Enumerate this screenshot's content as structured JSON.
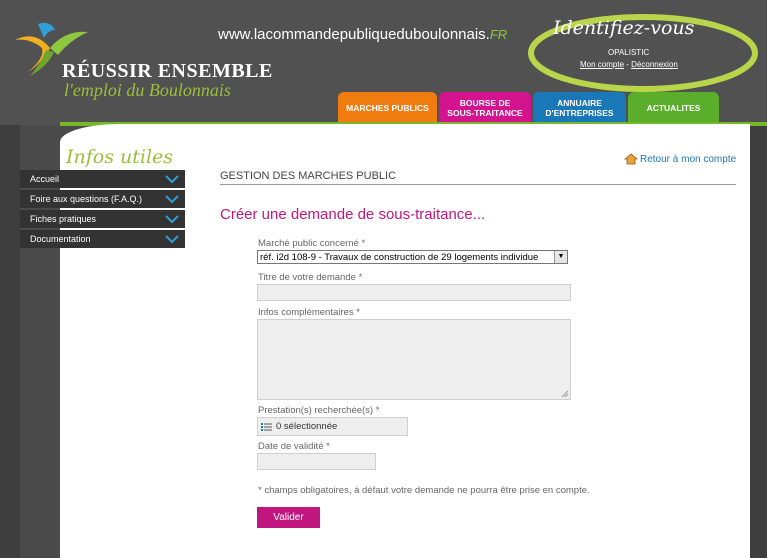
{
  "site": {
    "url": "www.lacommandepubliqueduboulonnais.",
    "url_suffix": "FR"
  },
  "brand": {
    "name": "RÉUSSIR ENSEMBLE",
    "tagline": "l'emploi du Boulonnais"
  },
  "login": {
    "title": "Identifiez-vous",
    "user": "OPALISTIC",
    "account_link": "Mon compte",
    "separator": " - ",
    "logout_link": "Déconnexion"
  },
  "nav": {
    "tabs": [
      {
        "label": "MARCHES PUBLICS",
        "color": "#f07c10"
      },
      {
        "label": "BOURSE DE\nSOUS-TRAITANCE",
        "color": "#d3148e"
      },
      {
        "label": "ANNUAIRE\nD'ENTREPRISES",
        "color": "#1a78b8"
      },
      {
        "label": "ACTUALITES",
        "color": "#5aae2c"
      }
    ]
  },
  "sidebar": {
    "title": "Infos utiles",
    "items": [
      {
        "label": "Accueil"
      },
      {
        "label": "Foire aux questions (F.A.Q.)"
      },
      {
        "label": "Fiches pratiques"
      },
      {
        "label": "Documentation"
      }
    ]
  },
  "main": {
    "retour_label": "Retour à mon compte",
    "section_title": "GESTION DES MARCHES PUBLIC",
    "form_title": "Créer une demande de sous-traitance...",
    "fields": {
      "marche_label": "Marché public concerné *",
      "marche_value": "réf. i2d 108-9 - Travaux de construction de 29 logements individue",
      "titre_label": "Titre de votre demande *",
      "infos_label": "Infos complémentaires *",
      "prestation_label": "Prestation(s) recherchée(s) *",
      "prestation_value": "0 sélectionnée",
      "date_label": "Date de validité *"
    },
    "note": "* champs obligatoires, à défaut votre demande ne pourra être prise en compte.",
    "submit_label": "Valider"
  },
  "colors": {
    "accent": "#c2167f",
    "green": "#77b82a",
    "link": "#1a78b8"
  }
}
